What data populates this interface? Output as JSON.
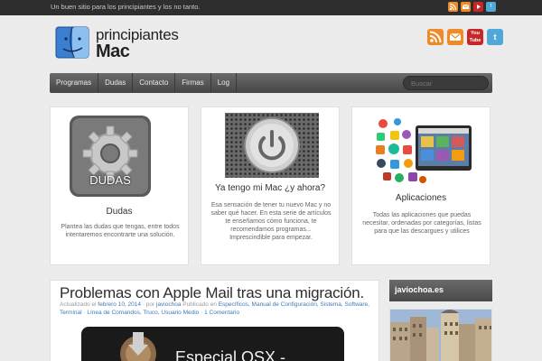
{
  "topbar": {
    "tagline": "Un buen sitio para los principiantes y los no tanto."
  },
  "header": {
    "logo_line1": "principiantes",
    "logo_line2": "Mac",
    "social_icons": [
      "rss-icon",
      "email-icon",
      "youtube-icon",
      "twitter-icon"
    ],
    "youtube_text": "You Tube",
    "twitter_text": "t"
  },
  "nav": {
    "items": [
      "Programas",
      "Dudas",
      "Contacto",
      "Firmas",
      "Log"
    ],
    "search_placeholder": "Buscar"
  },
  "cards": [
    {
      "image_caption": "DUDAS",
      "title": "Dudas",
      "text": "Plantea las dudas que tengas, entre todos intentaremos encontrarte una solución."
    },
    {
      "title": "Ya tengo mi Mac ¿y ahora?",
      "text": "Esa sensación de tener tu nuevo Mac y no saber qué hacer. En esta serie de artículos te enseñamos cómo funciona, te recomendamos programas... Imprescindible para empezar."
    },
    {
      "title": "Aplicaciones",
      "text": "Todas las aplicaciones que puedas necesitar, ordenadas por categorías, listas para que las descargues y utilices"
    }
  ],
  "article": {
    "title": "Problemas con Apple Mail tras una migración.",
    "meta": {
      "prefix": "Actualizado el",
      "date": "febrero 10, 2014",
      "by": "· por",
      "author": "javiochoa",
      "published_in": "Publicado en",
      "categories": "Específicos, Manual de Configuración, Sistema, Software, Terminal",
      "separator": "·",
      "tags": "Línea de Comandos, Truco, Usuario Medio",
      "comments": "1 Comentario"
    },
    "banner_text": "Especial OSX -"
  },
  "sidebar": {
    "widget_title": "javiochoa.es"
  },
  "colors": {
    "topbar": "#2e2e2e",
    "nav": "#555555",
    "link": "#3d7ab8",
    "rss": "#f08a24",
    "email": "#f08a24",
    "youtube": "#c8272a",
    "twitter": "#4fa8d8"
  }
}
